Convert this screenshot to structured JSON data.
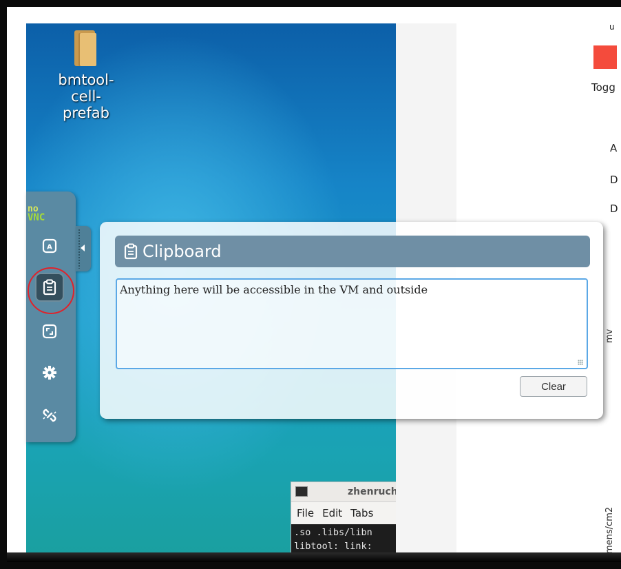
{
  "desktop": {
    "icon_label": "bmtool-\ncell-prefab"
  },
  "terminal": {
    "title": "zhenruch",
    "menu": [
      "File",
      "Edit",
      "Tabs"
    ],
    "lines": [
      ".so .libs/libn",
      "libtool: link:"
    ]
  },
  "right_page": {
    "top_text": "u",
    "toggle_label": "Togg",
    "letters": [
      "A",
      "D",
      "D"
    ],
    "vertical_mid": "mv",
    "vertical_bottom": "mens/cm2",
    "accent": "#f44b3c"
  },
  "novnc": {
    "logo_top": "no",
    "logo_bottom": "VNC",
    "buttons": [
      {
        "icon": "keyboard-icon"
      },
      {
        "icon": "clipboard-icon",
        "active": true
      },
      {
        "icon": "fullscreen-icon"
      },
      {
        "icon": "settings-icon"
      },
      {
        "icon": "disconnect-icon"
      }
    ]
  },
  "clipboard": {
    "title": "Clipboard",
    "text": "Anything here will be accessible in the VM and outside",
    "clear_label": "Clear"
  }
}
